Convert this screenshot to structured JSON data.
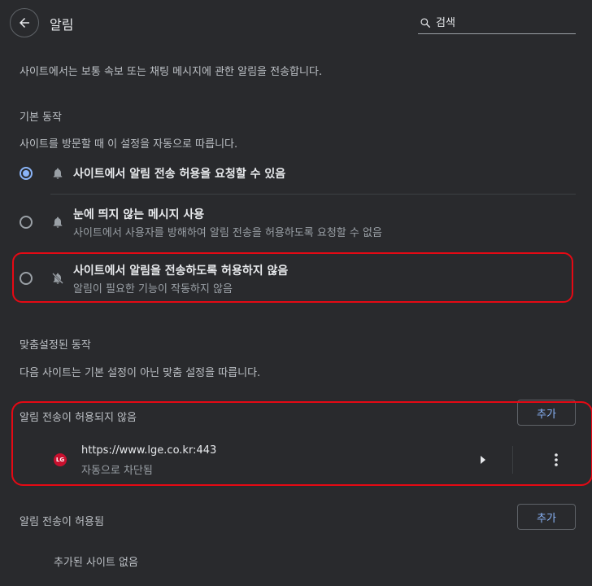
{
  "header": {
    "title": "알림",
    "search_value": "검색"
  },
  "intro_text": "사이트에서는 보통 속보 또는 채팅 메시지에 관한 알림을 전송합니다.",
  "default_behavior": {
    "heading": "기본 동작",
    "description": "사이트를 방문할 때 이 설정을 자동으로 따릅니다.",
    "options": [
      {
        "label": "사이트에서 알림 전송 허용을 요청할 수 있음",
        "sublabel": "",
        "selected": true,
        "icon": "bell-icon"
      },
      {
        "label": "눈에 띄지 않는 메시지 사용",
        "sublabel": "사이트에서 사용자를 방해하여 알림 전송을 허용하도록 요청할 수 없음",
        "selected": false,
        "icon": "bell-icon"
      },
      {
        "label": "사이트에서 알림을 전송하도록 허용하지 않음",
        "sublabel": "알림이 필요한 기능이 작동하지 않음",
        "selected": false,
        "icon": "bell-off-icon"
      }
    ]
  },
  "custom_behavior": {
    "heading": "맞춤설정된 동작",
    "description": "다음 사이트는 기본 설정이 아닌 맞춤 설정을 따릅니다.",
    "blocked": {
      "heading": "알림 전송이 허용되지 않음",
      "add_label": "추가",
      "sites": [
        {
          "favicon_text": "LG",
          "url": "https://www.lge.co.kr:443",
          "status": "자동으로 차단됨"
        }
      ]
    },
    "allowed": {
      "heading": "알림 전송이 허용됨",
      "add_label": "추가",
      "empty_text": "추가된 사이트 없음"
    }
  },
  "colors": {
    "background": "#292a2d",
    "accent": "#8ab4f8",
    "annotation_red": "#e50914"
  }
}
